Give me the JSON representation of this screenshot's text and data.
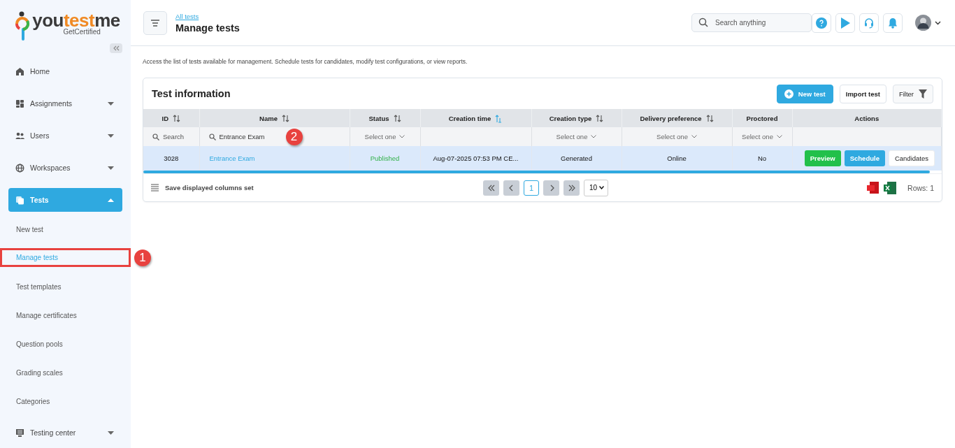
{
  "logo": {
    "parts": [
      "you",
      "test",
      "me"
    ],
    "tagline": "GetCertified"
  },
  "sidebar": {
    "items": [
      {
        "kind": "nav",
        "label": "Home",
        "selected": false
      },
      {
        "kind": "group",
        "label": "Assignments",
        "selected": false,
        "expanded": false
      },
      {
        "kind": "group",
        "label": "Users",
        "selected": false,
        "expanded": false
      },
      {
        "kind": "group",
        "label": "Workspaces",
        "selected": false,
        "expanded": false
      },
      {
        "kind": "group",
        "label": "Tests",
        "selected": true,
        "expanded": true,
        "children": [
          {
            "label": "New test",
            "selected": false
          },
          {
            "label": "Manage tests",
            "selected": true,
            "callout": "1"
          },
          {
            "label": "Test templates",
            "selected": false
          },
          {
            "label": "Manage certificates",
            "selected": false
          },
          {
            "label": "Question pools",
            "selected": false
          },
          {
            "label": "Grading scales",
            "selected": false
          },
          {
            "label": "Categories",
            "selected": false
          }
        ]
      },
      {
        "kind": "group",
        "label": "Testing center",
        "selected": false,
        "expanded": false
      }
    ]
  },
  "header": {
    "breadcrumb": "All tests",
    "title": "Manage tests",
    "search": {
      "placeholder": "Search anything"
    }
  },
  "description": "Access the list of tests available for management. Schedule tests for candidates, modify test configurations, or view reports.",
  "card": {
    "title": "Test information",
    "buttons": [
      {
        "kind": "primary",
        "label": "New test"
      },
      {
        "kind": "plain",
        "label": "Import test"
      },
      {
        "kind": "filter",
        "label": "Filter"
      }
    ]
  },
  "table": {
    "columns": [
      {
        "label": "ID",
        "sortable": true,
        "sorted": false
      },
      {
        "label": "Name",
        "sortable": true,
        "sorted": false
      },
      {
        "label": "Status",
        "sortable": true,
        "sorted": false
      },
      {
        "label": "Creation time",
        "sortable": true,
        "sorted": true
      },
      {
        "label": "Creation type",
        "sortable": true,
        "sorted": false
      },
      {
        "label": "Delivery preference",
        "sortable": true,
        "sorted": false
      },
      {
        "label": "Proctored",
        "sortable": false
      },
      {
        "label": "Actions",
        "sortable": false
      }
    ],
    "filters": [
      {
        "kind": "search",
        "placeholder": "Search"
      },
      {
        "kind": "search",
        "value": "Entrance Exam",
        "callout": "2"
      },
      {
        "kind": "select",
        "placeholder": "Select one"
      },
      {
        "kind": "empty"
      },
      {
        "kind": "select",
        "placeholder": "Select one"
      },
      {
        "kind": "select",
        "placeholder": "Select one"
      },
      {
        "kind": "select",
        "placeholder": "Select one"
      },
      {
        "kind": "empty"
      }
    ],
    "rows": [
      {
        "selected": true,
        "cells": [
          {
            "kind": "text",
            "text": "3028"
          },
          {
            "kind": "link",
            "text": "Entrance Exam"
          },
          {
            "kind": "status",
            "text": "Published"
          },
          {
            "kind": "text",
            "text": "Aug-07-2025 07:53 PM CE..."
          },
          {
            "kind": "text",
            "text": "Generated"
          },
          {
            "kind": "text",
            "text": "Online"
          },
          {
            "kind": "text",
            "text": "No"
          },
          {
            "kind": "actions",
            "buttons": [
              {
                "kind": "preview",
                "label": "Preview"
              },
              {
                "kind": "schedule",
                "label": "Schedule"
              },
              {
                "kind": "plain",
                "label": "Candidates"
              }
            ]
          }
        ]
      }
    ]
  },
  "footer": {
    "save_columns": "Save displayed columns set",
    "pages": [
      {
        "label": "1",
        "selected": true
      }
    ],
    "page_size": "10",
    "rows": "Rows: 1"
  }
}
